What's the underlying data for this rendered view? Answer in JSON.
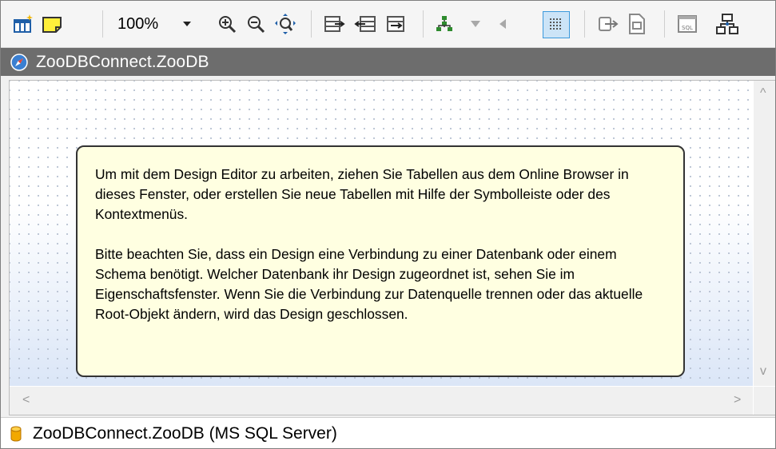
{
  "toolbar": {
    "zoom_value": "100%",
    "buttons": [
      "add-tables-icon",
      "add-note-icon",
      "zoom-dropdown-icon",
      "zoom-in-icon",
      "zoom-out-icon",
      "zoom-fit-icon",
      "expand-tables-icon",
      "collapse-tables-icon",
      "toggle-tables-icon",
      "auto-layout-icon",
      "layout-arrow-down-icon",
      "layout-arrow-left-icon",
      "grid-icon",
      "export-icon",
      "print-preview-icon",
      "sql-icon",
      "relationships-icon"
    ],
    "grid_active_color": "#cce4f7"
  },
  "title_bar": {
    "title": "ZooDBConnect.ZooDB",
    "icon": "design-compass-icon",
    "background": "#6d6d6d"
  },
  "info_box": {
    "paragraph1": "Um mit dem Design Editor zu arbeiten, ziehen Sie Tabellen aus dem Online Browser in dieses Fenster, oder erstellen Sie neue Tabellen mit Hilfe der Symbolleiste oder des Kontextmenüs.",
    "paragraph2": "Bitte beachten Sie, dass ein Design eine Verbindung zu einer Datenbank oder einem Schema benötigt. Welcher Datenbank ihr Design zugeordnet ist, sehen Sie im Eigenschaftsfenster. Wenn Sie die Verbindung zur Datenquelle trennen oder das aktuelle Root-Objekt ändern, wird das Design geschlossen.",
    "background": "#ffffe1"
  },
  "scrollbars": {
    "up": "^",
    "down": "v",
    "left": "<",
    "right": ">"
  },
  "status_bar": {
    "text": "ZooDBConnect.ZooDB (MS SQL Server)",
    "icon": "database-icon"
  }
}
